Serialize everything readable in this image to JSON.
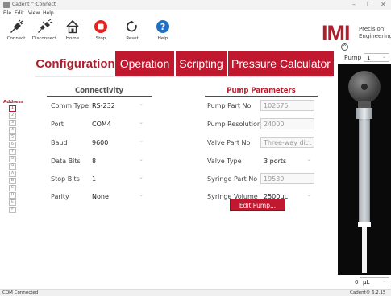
{
  "window": {
    "title": "Cadent™ Connect",
    "controls": [
      "–",
      "☐",
      "✕"
    ]
  },
  "menu": {
    "items": [
      "File",
      "Edit",
      "View",
      "Help"
    ]
  },
  "toolbar": {
    "connect": "Connect",
    "disconnect": "Disconnect",
    "home": "Home",
    "stop": "Stop",
    "reset": "Reset",
    "help": "Help"
  },
  "logo": {
    "brand": "IMI",
    "line1": "Precision",
    "line2": "Engineering",
    "collapse_glyph": "^"
  },
  "tabs": {
    "configuration": "Configuration",
    "operation": "Operation",
    "scripting": "Scripting",
    "pressure": "Pressure Calculator"
  },
  "address": {
    "label": "Address",
    "items": [
      "1",
      "2",
      "3",
      "4",
      "5",
      "6",
      "7",
      "8",
      "9",
      "A",
      "B",
      "C",
      "D",
      "E",
      "F"
    ],
    "selected": "1"
  },
  "connectivity": {
    "title": "Connectivity",
    "fields": [
      {
        "label": "Comm Type",
        "value": "RS-232"
      },
      {
        "label": "Port",
        "value": "COM4"
      },
      {
        "label": "Baud",
        "value": "9600"
      },
      {
        "label": "Data Bits",
        "value": "8"
      },
      {
        "label": "Stop Bits",
        "value": "1"
      },
      {
        "label": "Parity",
        "value": "None"
      }
    ]
  },
  "pump_params": {
    "title": "Pump Parameters",
    "part_no_label": "Pump Part No",
    "part_no": "102675",
    "resolution_label": "Pump Resolution",
    "resolution": "24000",
    "valve_part_label": "Valve Part No",
    "valve_part": "Three-way dist",
    "valve_type_label": "Valve Type",
    "valve_type": "3 ports",
    "syringe_part_label": "Syringe Part No",
    "syringe_part": "19539",
    "syringe_volume_label": "Syringe Volume",
    "syringe_volume": "2500µL",
    "edit_button": "Edit Pump..."
  },
  "pump_panel": {
    "label": "Pump",
    "selected": "1",
    "volume_value": "0",
    "volume_unit": "µL"
  },
  "status": {
    "left": "COM Connected",
    "right": "Cadent® 6.2.15"
  },
  "colors": {
    "brand_red": "#c0182f",
    "accent_text": "#b01e2d"
  }
}
